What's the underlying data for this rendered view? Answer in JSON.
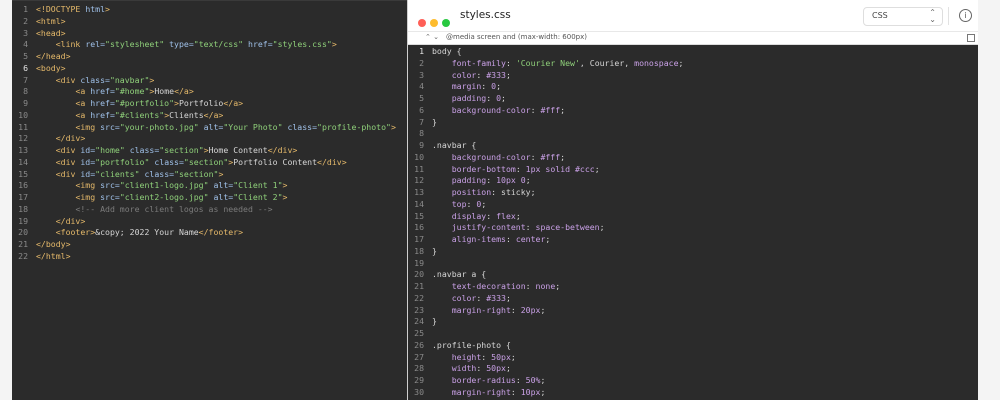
{
  "html_editor": {
    "lines": [
      {
        "n": "1",
        "html": "<span class='doctype'>&lt;!DOCTYPE</span> <span class='attr'>html</span><span class='doctype'>&gt;</span>"
      },
      {
        "n": "2",
        "html": "<span class='tag'>&lt;html&gt;</span>"
      },
      {
        "n": "3",
        "html": "<span class='tag'>&lt;head&gt;</span>"
      },
      {
        "n": "4",
        "html": "    <span class='tag'>&lt;link</span> <span class='attr'>rel=</span><span class='val'>\"stylesheet\"</span> <span class='attr'>type=</span><span class='val'>\"text/css\"</span> <span class='attr'>href=</span><span class='val'>\"styles.css\"</span><span class='tag'>&gt;</span>"
      },
      {
        "n": "5",
        "html": "<span class='tag'>&lt;/head&gt;</span>"
      },
      {
        "n": "6",
        "html": "<span class='tag'>&lt;body&gt;</span>"
      },
      {
        "n": "7",
        "html": "    <span class='tag'>&lt;div</span> <span class='attr'>class=</span><span class='val'>\"navbar\"</span><span class='tag'>&gt;</span>"
      },
      {
        "n": "8",
        "html": "        <span class='tag'>&lt;a</span> <span class='attr'>href=</span><span class='val'>\"#home\"</span><span class='tag'>&gt;</span>Home<span class='tag'>&lt;/a&gt;</span>"
      },
      {
        "n": "9",
        "html": "        <span class='tag'>&lt;a</span> <span class='attr'>href=</span><span class='val'>\"#portfolio\"</span><span class='tag'>&gt;</span>Portfolio<span class='tag'>&lt;/a&gt;</span>"
      },
      {
        "n": "10",
        "html": "        <span class='tag'>&lt;a</span> <span class='attr'>href=</span><span class='val'>\"#clients\"</span><span class='tag'>&gt;</span>Clients<span class='tag'>&lt;/a&gt;</span>"
      },
      {
        "n": "11",
        "html": "        <span class='tag'>&lt;img</span> <span class='attr'>src=</span><span class='val'>\"your-photo.jpg\"</span> <span class='attr'>alt=</span><span class='val'>\"Your Photo\"</span> <span class='attr'>class=</span><span class='val'>\"profile-photo\"</span><span class='tag'>&gt;</span>"
      },
      {
        "n": "12",
        "html": "    <span class='tag'>&lt;/div&gt;</span>"
      },
      {
        "n": "13",
        "html": "    <span class='tag'>&lt;div</span> <span class='attr'>id=</span><span class='val'>\"home\"</span> <span class='attr'>class=</span><span class='val'>\"section\"</span><span class='tag'>&gt;</span>Home Content<span class='tag'>&lt;/div&gt;</span>"
      },
      {
        "n": "14",
        "html": "    <span class='tag'>&lt;div</span> <span class='attr'>id=</span><span class='val'>\"portfolio\"</span> <span class='attr'>class=</span><span class='val'>\"section\"</span><span class='tag'>&gt;</span>Portfolio Content<span class='tag'>&lt;/div&gt;</span>"
      },
      {
        "n": "15",
        "html": "    <span class='tag'>&lt;div</span> <span class='attr'>id=</span><span class='val'>\"clients\"</span> <span class='attr'>class=</span><span class='val'>\"section\"</span><span class='tag'>&gt;</span>"
      },
      {
        "n": "16",
        "html": "        <span class='tag'>&lt;img</span> <span class='attr'>src=</span><span class='val'>\"client1-logo.jpg\"</span> <span class='attr'>alt=</span><span class='val'>\"Client 1\"</span><span class='tag'>&gt;</span>"
      },
      {
        "n": "17",
        "html": "        <span class='tag'>&lt;img</span> <span class='attr'>src=</span><span class='val'>\"client2-logo.jpg\"</span> <span class='attr'>alt=</span><span class='val'>\"Client 2\"</span><span class='tag'>&gt;</span>"
      },
      {
        "n": "18",
        "html": "        <span class='comment'>&lt;!-- Add more client logos as needed --&gt;</span>"
      },
      {
        "n": "19",
        "html": "    <span class='tag'>&lt;/div&gt;</span>"
      },
      {
        "n": "20",
        "html": "    <span class='tag'>&lt;footer&gt;</span>&amp;copy; 2022 Your Name<span class='tag'>&lt;/footer&gt;</span>"
      },
      {
        "n": "21",
        "html": "<span class='tag'>&lt;/body&gt;</span>"
      },
      {
        "n": "22",
        "html": "<span class='tag'>&lt;/html&gt;</span>"
      }
    ],
    "current_line": "6"
  },
  "css_window": {
    "title": "styles.css",
    "language": "CSS",
    "info_label": "i",
    "media_query": "@media  screen and (max-width: 600px)",
    "traffic_lights": [
      "#ff5f57",
      "#febc2e",
      "#28c840"
    ],
    "current_line": "1",
    "lines": [
      {
        "n": "1",
        "html": "<span class='sel'>body {</span>"
      },
      {
        "n": "2",
        "html": "    <span class='prop'>font-family</span>: <span class='str'>'Courier New'</span>, Courier, <span class='kw'>monospace</span>;"
      },
      {
        "n": "3",
        "html": "    <span class='prop'>color</span>: <span class='hex'>#333</span>;"
      },
      {
        "n": "4",
        "html": "    <span class='prop'>margin</span>: <span class='num'>0</span>;"
      },
      {
        "n": "5",
        "html": "    <span class='prop'>padding</span>: <span class='num'>0</span>;"
      },
      {
        "n": "6",
        "html": "    <span class='prop'>background-color</span>: <span class='hex'>#fff</span>;"
      },
      {
        "n": "7",
        "html": "<span class='sel'>}</span>"
      },
      {
        "n": "8",
        "html": ""
      },
      {
        "n": "9",
        "html": "<span class='sel'>.navbar {</span>"
      },
      {
        "n": "10",
        "html": "    <span class='prop'>background-color</span>: <span class='hex'>#fff</span>;"
      },
      {
        "n": "11",
        "html": "    <span class='prop'>border-bottom</span>: <span class='num'>1px</span> <span class='kw'>solid</span> <span class='hex'>#ccc</span>;"
      },
      {
        "n": "12",
        "html": "    <span class='prop'>padding</span>: <span class='num'>10px</span> <span class='num'>0</span>;"
      },
      {
        "n": "13",
        "html": "    <span class='prop'>position</span>: sticky;"
      },
      {
        "n": "14",
        "html": "    <span class='prop'>top</span>: <span class='num'>0</span>;"
      },
      {
        "n": "15",
        "html": "    <span class='prop'>display</span>: <span class='kw'>flex</span>;"
      },
      {
        "n": "16",
        "html": "    <span class='prop'>justify-content</span>: <span class='kw'>space-between</span>;"
      },
      {
        "n": "17",
        "html": "    <span class='prop'>align-items</span>: <span class='kw'>center</span>;"
      },
      {
        "n": "18",
        "html": "<span class='sel'>}</span>"
      },
      {
        "n": "19",
        "html": ""
      },
      {
        "n": "20",
        "html": "<span class='sel'>.navbar a {</span>"
      },
      {
        "n": "21",
        "html": "    <span class='prop'>text-decoration</span>: <span class='kw'>none</span>;"
      },
      {
        "n": "22",
        "html": "    <span class='prop'>color</span>: <span class='hex'>#333</span>;"
      },
      {
        "n": "23",
        "html": "    <span class='prop'>margin-right</span>: <span class='num'>20px</span>;"
      },
      {
        "n": "24",
        "html": "<span class='sel'>}</span>"
      },
      {
        "n": "25",
        "html": ""
      },
      {
        "n": "26",
        "html": "<span class='sel'>.profile-photo {</span>"
      },
      {
        "n": "27",
        "html": "    <span class='prop'>height</span>: <span class='num'>50px</span>;"
      },
      {
        "n": "28",
        "html": "    <span class='prop'>width</span>: <span class='num'>50px</span>;"
      },
      {
        "n": "29",
        "html": "    <span class='prop'>border-radius</span>: <span class='num'>50%</span>;"
      },
      {
        "n": "30",
        "html": "    <span class='prop'>margin-right</span>: <span class='num'>10px</span>;"
      }
    ]
  }
}
